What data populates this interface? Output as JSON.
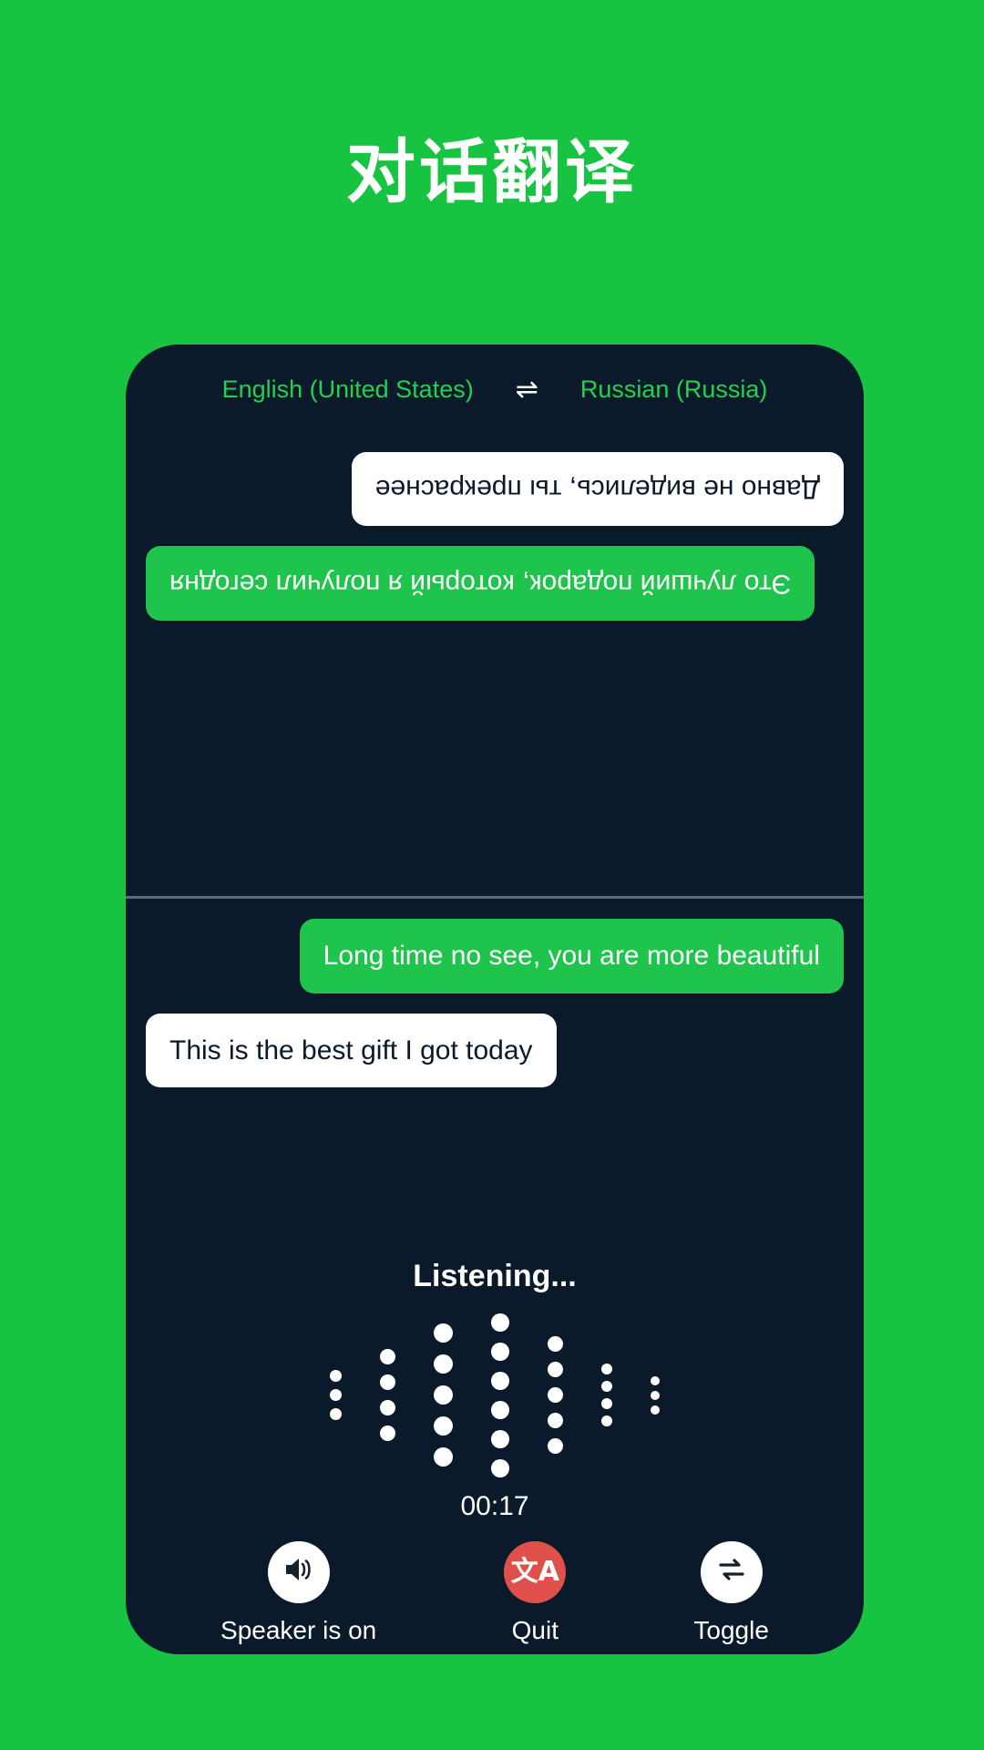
{
  "page": {
    "title": "对话翻译",
    "background_color": "#16c441"
  },
  "card": {
    "background_color": "#0b1a2a"
  },
  "language_bar": {
    "source_language": "English (United States)",
    "swap_icon": "swap-horizontal-icon",
    "swap_glyph": "⇌",
    "target_language": "Russian (Russia)",
    "text_color": "#22d24d"
  },
  "conversation": {
    "remote_pane": {
      "rotated": true,
      "messages": [
        {
          "text": "Это лучший подарок, который я получил сегодня",
          "style": "green",
          "align": "end"
        },
        {
          "text": "Давно не виделись, ты прекраснее",
          "style": "white",
          "align": "start"
        }
      ]
    },
    "local_pane": {
      "rotated": false,
      "messages": [
        {
          "text": "Long time no see, you are more beautiful",
          "style": "green",
          "align": "end"
        },
        {
          "text": "This is the best gift I got today",
          "style": "white",
          "align": "start"
        }
      ]
    }
  },
  "status": {
    "listening_label": "Listening...",
    "timer": "00:17"
  },
  "waveform": {
    "columns": [
      {
        "dots": 3,
        "size": 13
      },
      {
        "dots": 4,
        "size": 17
      },
      {
        "dots": 5,
        "size": 21
      },
      {
        "dots": 6,
        "size": 20
      },
      {
        "dots": 5,
        "size": 17
      },
      {
        "dots": 4,
        "size": 12
      },
      {
        "dots": 3,
        "size": 10
      }
    ],
    "dot_color": "#ffffff"
  },
  "controls": [
    {
      "label": "Speaker is on",
      "icon": "speaker-on-icon",
      "glyph": "🔊",
      "circle": "light"
    },
    {
      "label": "Quit",
      "icon": "translate-icon",
      "glyph": "文A",
      "circle": "danger",
      "circle_color": "#e0504a"
    },
    {
      "label": "Toggle",
      "icon": "swap-arrows-icon",
      "glyph": "⇄",
      "circle": "light"
    }
  ]
}
